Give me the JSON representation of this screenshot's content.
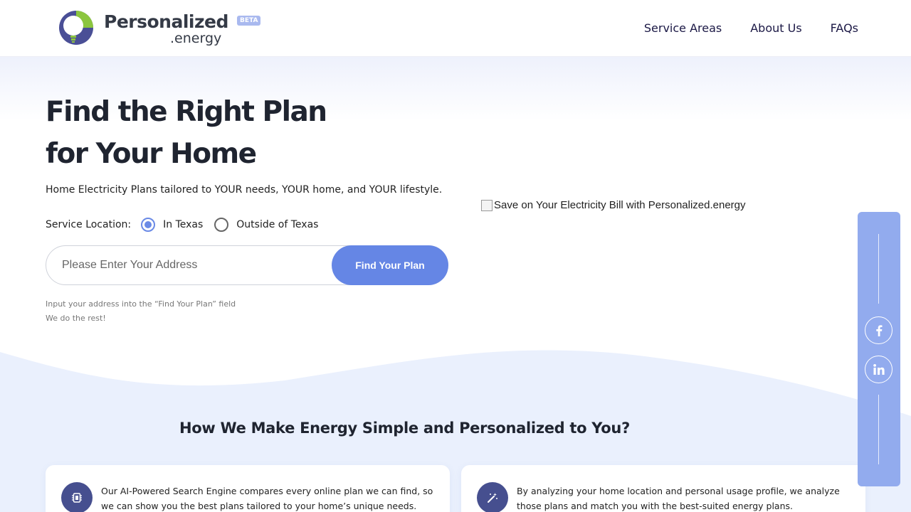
{
  "header": {
    "logo_word": "Personalized",
    "logo_sub": ".energy",
    "beta": "BETA",
    "nav": [
      "Service Areas",
      "About Us",
      "FAQs"
    ]
  },
  "hero": {
    "title_line1": "Find the Right Plan",
    "title_line2": "for Your Home",
    "subtitle": "Home Electricity Plans tailored to YOUR needs, YOUR home, and YOUR lifestyle.",
    "location_label": "Service Location:",
    "options": [
      {
        "label": "In Texas",
        "checked": true
      },
      {
        "label": "Outside of Texas",
        "checked": false
      }
    ],
    "address_placeholder": "Please Enter Your Address",
    "address_value": "",
    "button_label": "Find Your Plan",
    "hint_line1": "Input your address into the “Find Your Plan” field",
    "hint_line2": "We do the rest!",
    "image_alt": "Save on Your Electricity Bill with Personalized.energy"
  },
  "section": {
    "title": "How We Make Energy Simple and Personalized to You?",
    "cards": [
      {
        "icon": "chip-icon",
        "text": "Our AI-Powered Search Engine compares every online plan we can find, so we can show you the best plans tailored to your home’s unique needs."
      },
      {
        "icon": "magic-wand-icon",
        "text": "By analyzing your home location and personal usage profile, we analyze those plans and match you with the best-suited energy plans."
      }
    ]
  },
  "social": {
    "icons": [
      "facebook-icon",
      "linkedin-icon"
    ]
  },
  "colors": {
    "accent": "#6586e5",
    "social_bar": "#92abee",
    "icon_bg": "#464f8f",
    "wave": "#eaf0fd"
  }
}
